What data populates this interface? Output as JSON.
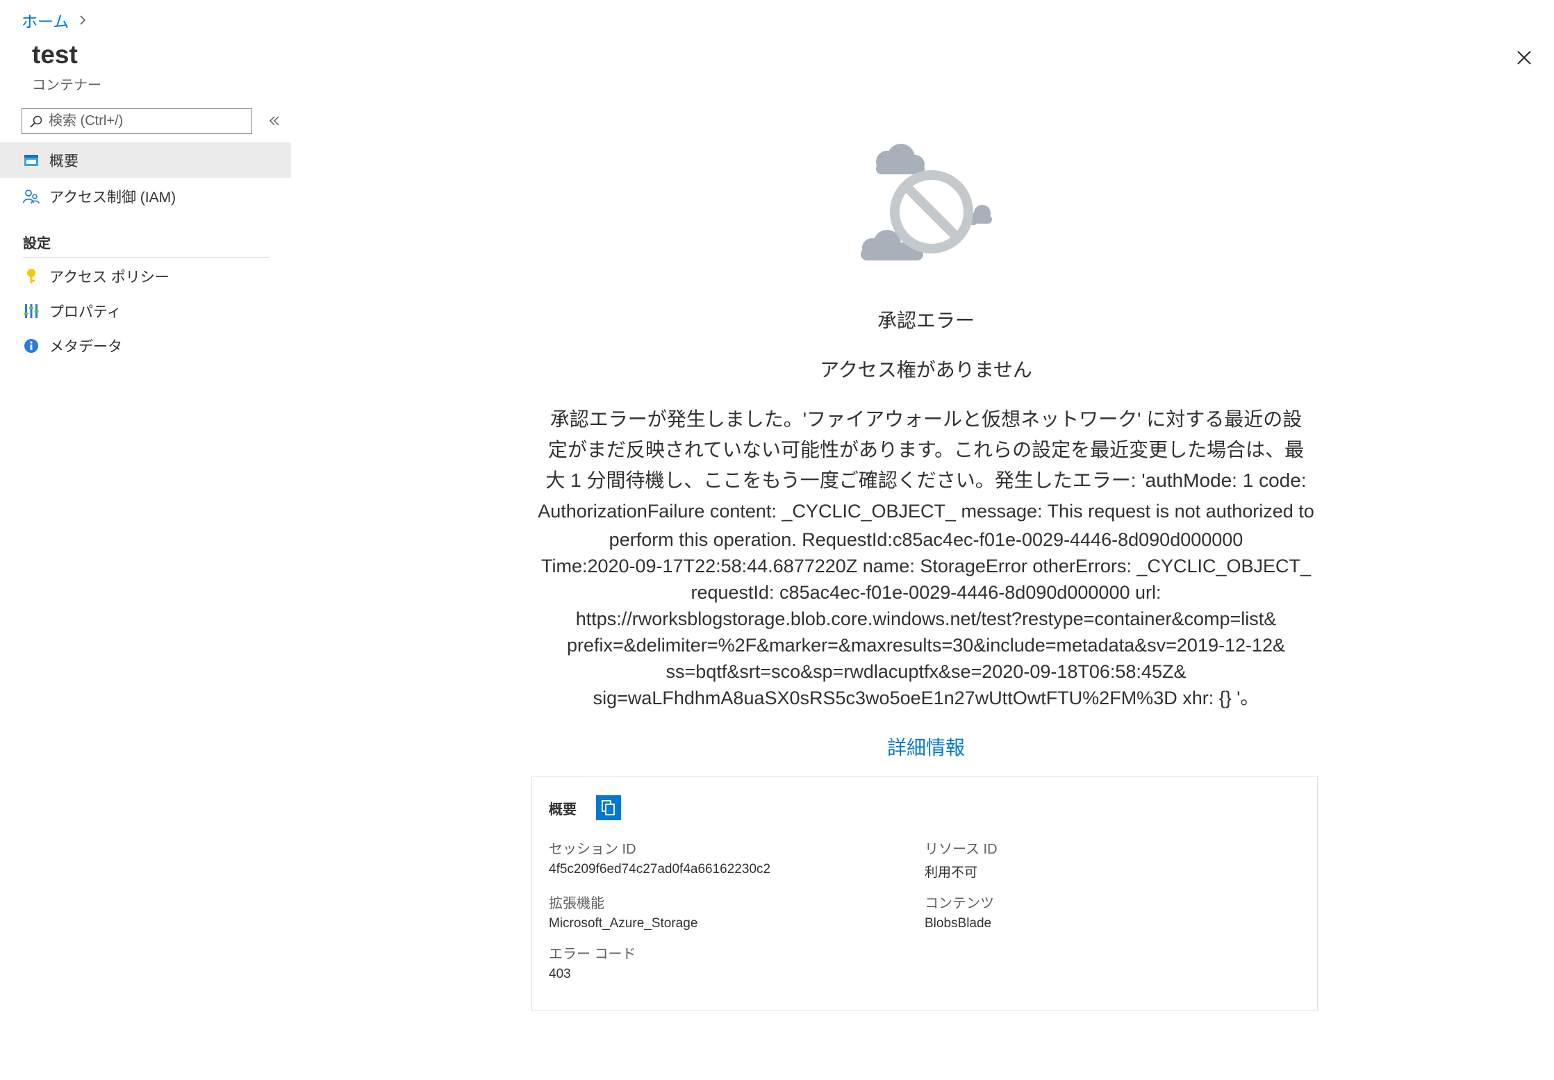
{
  "breadcrumb": {
    "home": "ホーム"
  },
  "header": {
    "title": "test",
    "subtitle": "コンテナー"
  },
  "search": {
    "placeholder": "検索 (Ctrl+/)"
  },
  "sidebar": {
    "items": [
      {
        "label": "概要",
        "icon": "overview-icon"
      },
      {
        "label": "アクセス制御 (IAM)",
        "icon": "people-icon"
      }
    ],
    "section_label": "設定",
    "settings_items": [
      {
        "label": "アクセス ポリシー",
        "icon": "key-icon"
      },
      {
        "label": "プロパティ",
        "icon": "properties-icon"
      },
      {
        "label": "メタデータ",
        "icon": "info-icon"
      }
    ]
  },
  "error": {
    "title": "承認エラー",
    "subtitle": "アクセス権がありません",
    "message_lines": [
      "承認エラーが発生しました。'ファイアウォールと仮想ネットワーク' に対する最近の設",
      "定がまだ反映されていない可能性があります。これらの設定を最近変更した場合は、最",
      "大 1 分間待機し、ここをもう一度ご確認ください。発生したエラー: 'authMode: 1 code:",
      "AuthorizationFailure content: _CYCLIC_OBJECT_ message: This request is not authorized to",
      "perform this operation. RequestId:c85ac4ec-f01e-0029-4446-8d090d000000",
      "Time:2020-09-17T22:58:44.6877220Z name: StorageError otherErrors: _CYCLIC_OBJECT_",
      "requestId: c85ac4ec-f01e-0029-4446-8d090d000000 url:",
      "https://rworksblogstorage.blob.core.windows.net/test?restype=container&comp=list&",
      "prefix=&delimiter=%2F&marker=&maxresults=30&include=metadata&sv=2019-12-12&",
      "ss=bqtf&srt=sco&sp=rwdlacuptfx&se=2020-09-18T06:58:45Z&",
      "sig=waLFhdhmA8uaSX0sRS5c3wo5oeE1n27wUttOwtFTU%2FM%3D xhr: {} '。"
    ],
    "more_info": "詳細情報"
  },
  "summary": {
    "title": "概要",
    "fields": [
      {
        "key": "セッション ID",
        "value": "4f5c209f6ed74c27ad0f4a66162230c2"
      },
      {
        "key": "リソース ID",
        "value": "利用不可"
      },
      {
        "key": "拡張機能",
        "value": "Microsoft_Azure_Storage"
      },
      {
        "key": "コンテンツ",
        "value": "BlobsBlade"
      },
      {
        "key": "エラー コード",
        "value": "403"
      }
    ]
  },
  "colors": {
    "accent": "#0078d4",
    "text": "#323130",
    "muted": "#605e5c",
    "active_bg": "#ebebeb",
    "icon_gray": "#a8b0b9"
  }
}
